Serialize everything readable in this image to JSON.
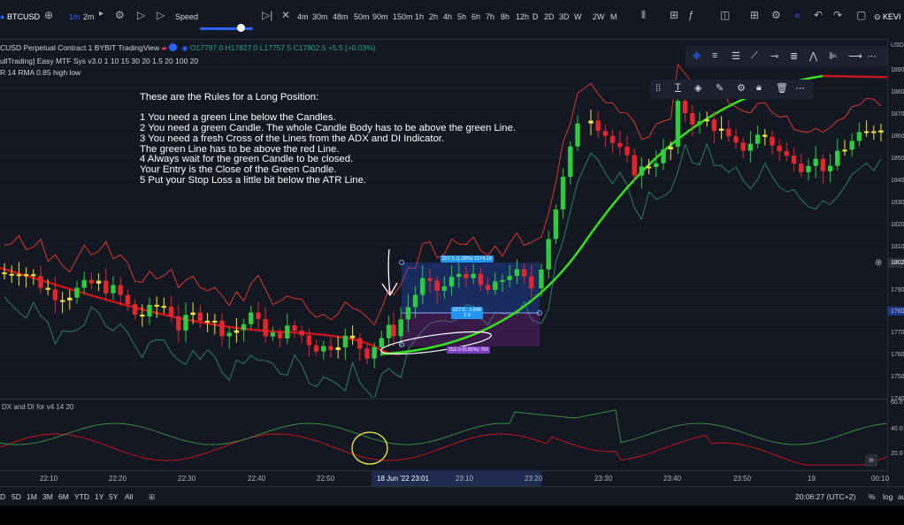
{
  "header": {
    "symbol": "BTCUSD",
    "timeframes_top": [
      "1m",
      "2m"
    ],
    "speed_label": "Speed",
    "intervals": [
      "4m",
      "30m",
      "48m",
      "50m",
      "90m",
      "150m",
      "1h",
      "2h",
      "4h",
      "5h",
      "6h",
      "7h",
      "8h",
      "12h",
      "D",
      "2D",
      "3D",
      "W",
      "2W",
      "M"
    ],
    "user": "KEVI"
  },
  "legend": {
    "title": "CUSD Perpetual Contract  1  BYBIT  TradingView",
    "open": "O17797.0",
    "high": "H17827.0",
    "low": "L17757.5",
    "close": "C17802.5",
    "change": "+5.5 (+0.03%)",
    "indicator1": "ullTrading] Easy MTF Sys v3.0  1 10 15 30 20 1.5 20 100 20",
    "indicator2": "R 14 RMA 0.85 high low"
  },
  "rules": [
    "These are the Rules for a Long Position:",
    "",
    "1 You need a green Line below the Candles.",
    "2 You need a green Candle. The whole Candle Body has to be above the green Line.",
    "3 You need a fresh Cross of the Lines from the ADX and DI Indicator.",
    "The green Line has to be above the red Line.",
    "4 Always wait for the green Candle to be closed.",
    "Your Entry is the Close of the Green Candle.",
    "5 Put your Stop Loss a little bit below the ATR Line."
  ],
  "position_tool": {
    "target_label": "227.5 (1.28%) 1374.18",
    "entry_label": "227.5 : 1.645",
    "entry_label2": "1.5",
    "stop_label": "152.0 (0.85%) 750"
  },
  "price_axis": {
    "currency": "USD",
    "ticks": [
      "1890",
      "1880",
      "1870",
      "1860",
      "1850",
      "1840",
      "1830",
      "1820",
      "1810",
      "1800",
      "1790",
      "1780",
      "1770",
      "1760",
      "1750",
      "1740"
    ],
    "current_price": "1802",
    "sub_ticks": [
      "60.0",
      "40.0",
      "20.0"
    ]
  },
  "sub_pane": {
    "legend": "DX and DI for v4  14 20"
  },
  "time_axis": {
    "ticks": [
      "22:10",
      "22:20",
      "22:30",
      "22:40",
      "22:50",
      "23:10",
      "23:20",
      "23:30",
      "23:40",
      "23:50",
      "19",
      "00:10"
    ],
    "highlight": "18 Jun '22  23:01"
  },
  "bottom": {
    "ranges": [
      "D",
      "5D",
      "1M",
      "3M",
      "6M",
      "YTD",
      "1Y",
      "5Y",
      "All"
    ],
    "clock": "20:06:27 (UTC+2)",
    "pct": "%",
    "log": "log",
    "auto": "auto"
  },
  "colors": {
    "background": "#131722",
    "up_candle": "#2ecc40",
    "down_candle": "#e5262e",
    "neutral_candle": "#f5e642",
    "red_line": "#c4161c",
    "green_line": "#39e11f",
    "atr_upper": "#d8392b",
    "atr_lower": "#2a7f62"
  },
  "icons": [
    "plus-icon",
    "bar-style-icon",
    "indicators-icon",
    "replay-icon",
    "play-icon",
    "undo-icon",
    "redo-icon",
    "camera-icon",
    "fullscreen-icon"
  ]
}
